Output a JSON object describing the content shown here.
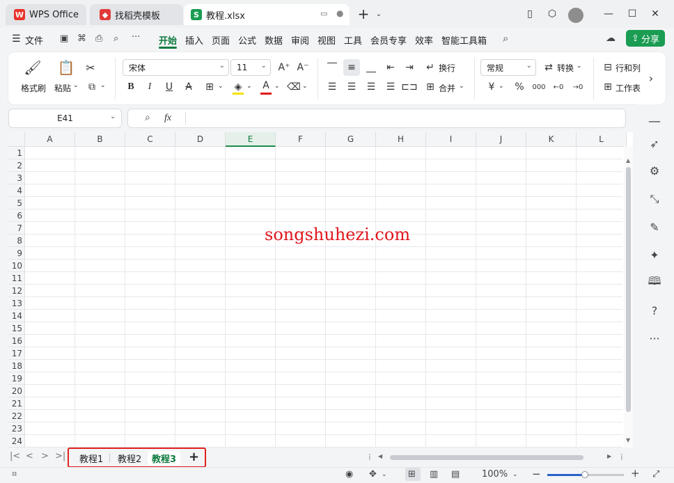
{
  "titlebar": {
    "tabs": [
      {
        "label": "WPS Office",
        "icon": "wps-logo-icon"
      },
      {
        "label": "找稻壳模板",
        "icon": "docer-icon"
      },
      {
        "label": "教程.xlsx",
        "icon": "spreadsheet-s-icon"
      }
    ],
    "sheet_icon_letter": "S"
  },
  "menubar": {
    "file": "文件",
    "items": [
      "开始",
      "插入",
      "页面",
      "公式",
      "数据",
      "审阅",
      "视图",
      "工具",
      "会员专享",
      "效率",
      "智能工具箱"
    ],
    "active": "开始",
    "share": "分享"
  },
  "ribbon": {
    "format_painter": "格式刷",
    "paste": "粘贴",
    "font_name": "宋体",
    "font_size": "11",
    "wrap": "换行",
    "merge": "合并",
    "number_format": "常规",
    "convert": "转换",
    "rows_cols": "行和列",
    "worksheet": "工作表",
    "bold": "B",
    "italic": "I",
    "underline": "U",
    "strike": "A",
    "currency": "¥",
    "percent": "%"
  },
  "formula_bar": {
    "cell_ref": "E41",
    "fx": "fx",
    "value": ""
  },
  "sheet": {
    "columns": [
      "A",
      "B",
      "C",
      "D",
      "E",
      "F",
      "G",
      "H",
      "I",
      "J",
      "K",
      "L"
    ],
    "selected_column": "E",
    "rows": [
      "1",
      "2",
      "3",
      "4",
      "5",
      "6",
      "7",
      "8",
      "9",
      "10",
      "11",
      "12",
      "13",
      "14",
      "15",
      "16",
      "17",
      "18",
      "19",
      "20",
      "21",
      "22",
      "23",
      "24"
    ]
  },
  "watermark": "songshuhezi.com",
  "sheet_tabs": {
    "tabs": [
      "教程1",
      "教程2",
      "教程3"
    ],
    "active": "教程3",
    "add": "+"
  },
  "statusbar": {
    "zoom": "100%",
    "zoom_level": 0.5,
    "minus": "−",
    "plus": "+"
  },
  "colors": {
    "accent": "#0f7a40",
    "share_bg": "#1b9c53",
    "highlight_box": "#e32020",
    "watermark": "#e0161c"
  }
}
